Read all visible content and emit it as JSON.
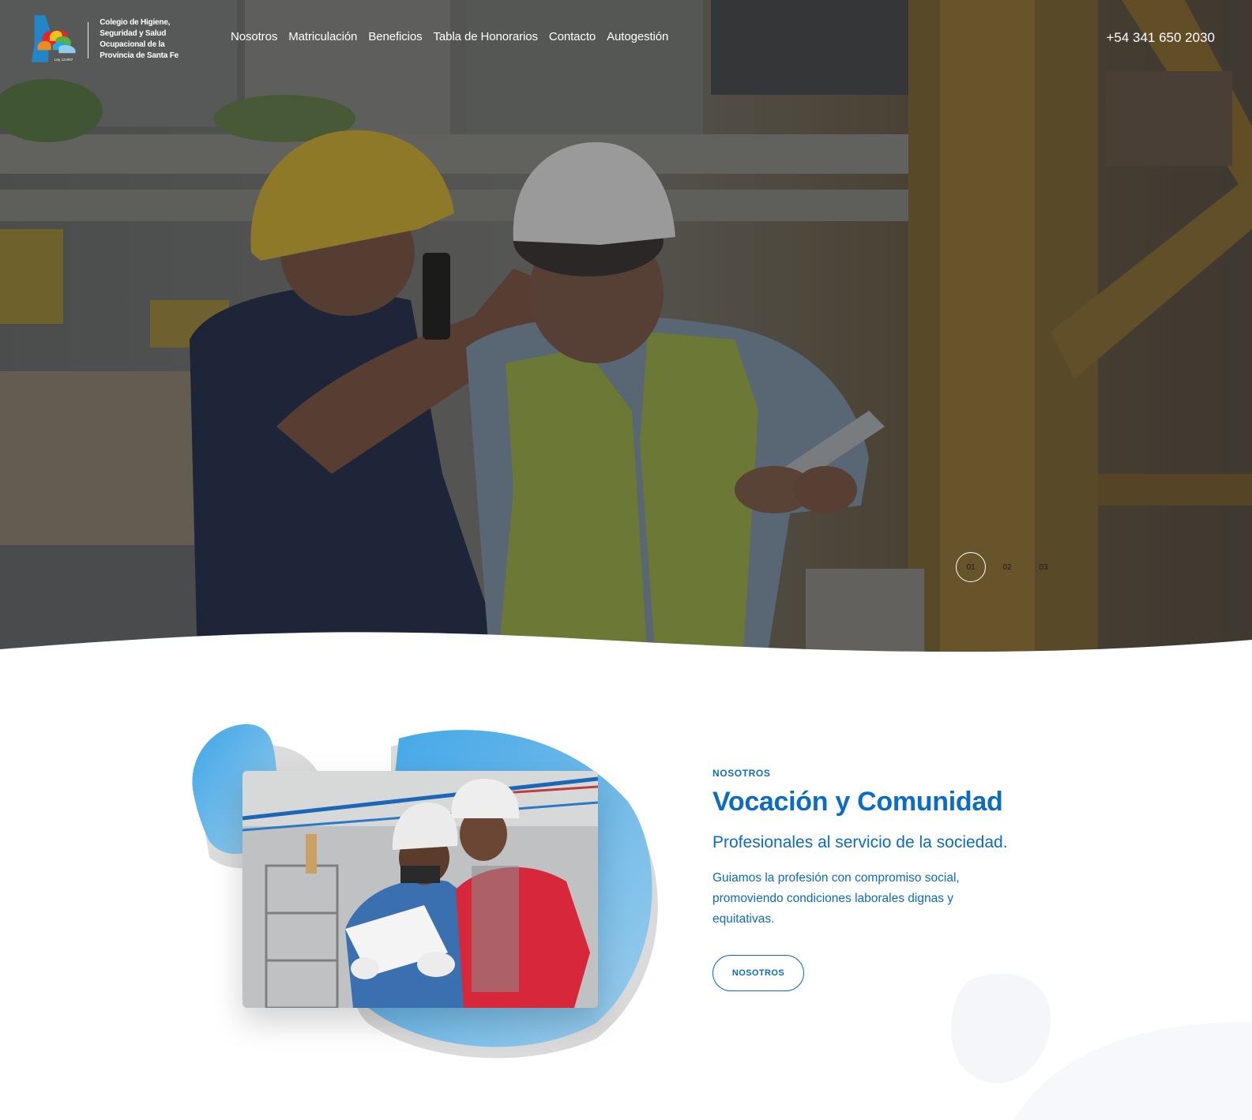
{
  "brand": {
    "logo_lines": [
      "Colegio de Higiene,",
      "Seguridad y Salud",
      "Ocupacional de la",
      "Provincia de Santa Fe"
    ],
    "logo_law": "Ley 13.907"
  },
  "nav": {
    "items": [
      "Nosotros",
      "Matriculación",
      "Beneficios",
      "Tabla de Honorarios",
      "Contacto",
      "Autogestión"
    ]
  },
  "phone": "+54 341 650 2030",
  "slider": {
    "dots": [
      "01",
      "02",
      "03"
    ],
    "active_index": 0
  },
  "about": {
    "eyebrow": "NOSOTROS",
    "title": "Vocación y Comunidad",
    "subtitle": "Profesionales al servicio de la sociedad.",
    "body": "Guiamos la profesión con compromiso social, promoviendo condiciones laborales dignas y equitativas.",
    "button": "NOSOTROS"
  },
  "colors": {
    "primary": "#0c6bc2",
    "blob_blue": "#5fb0e3",
    "overlay": "#4a4c4f"
  }
}
